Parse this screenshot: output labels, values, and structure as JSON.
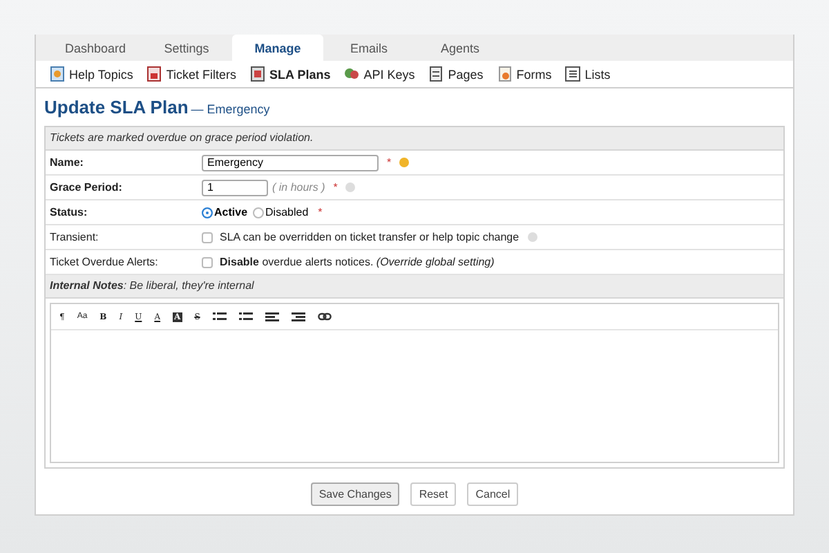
{
  "tabs": [
    {
      "label": "Dashboard",
      "selected": false
    },
    {
      "label": "Settings",
      "selected": false
    },
    {
      "label": "Manage",
      "selected": true
    },
    {
      "label": "Emails",
      "selected": false
    },
    {
      "label": "Agents",
      "selected": false
    }
  ],
  "subnav": [
    {
      "label": "Help Topics",
      "selected": false
    },
    {
      "label": "Ticket Filters",
      "selected": false
    },
    {
      "label": "SLA Plans",
      "selected": true
    },
    {
      "label": "API Keys",
      "selected": false
    },
    {
      "label": "Pages",
      "selected": false
    },
    {
      "label": "Forms",
      "selected": false
    },
    {
      "label": "Lists",
      "selected": false
    }
  ],
  "page_title": "Update SLA Plan",
  "page_subtitle": "— Emergency",
  "form": {
    "header": "Tickets are marked overdue on grace period violation.",
    "rows": [
      {
        "kind": "text",
        "label": "Name:",
        "required": true,
        "value": "Emergency",
        "mark": "*",
        "help": true
      },
      {
        "kind": "number",
        "label": "Grace Period:",
        "required": true,
        "value": "1",
        "unit": "( in hours )",
        "mark": "*",
        "help": true
      },
      {
        "kind": "radio",
        "label": "Status:",
        "required": true,
        "mark": "*",
        "options": [
          {
            "label": "Active",
            "selected": true
          },
          {
            "label": "Disabled",
            "selected": false
          }
        ]
      },
      {
        "kind": "checkbox",
        "label": "Transient:",
        "required": false,
        "checked": false,
        "text": "SLA can be overridden on ticket transfer or help topic change",
        "help": true
      },
      {
        "kind": "checkbox",
        "label": "Ticket Overdue Alerts:",
        "required": false,
        "checked": false,
        "text": "**Disable** overdue alerts notices. *(Override global setting)*",
        "help": false
      }
    ],
    "notes_header": "**Internal Notes**: Be liberal, they're internal",
    "toolbar": [
      {
        "kind": "glyph",
        "label": "¶"
      },
      {
        "kind": "glyph",
        "label": "Aa"
      },
      {
        "kind": "glyph",
        "label": "B"
      },
      {
        "kind": "glyph",
        "label": "I"
      },
      {
        "kind": "glyph",
        "label": "U"
      },
      {
        "kind": "glyph",
        "label": "A"
      },
      {
        "kind": "boxed",
        "label": "A"
      },
      {
        "kind": "glyph",
        "label": "S"
      },
      {
        "kind": "bullet-list"
      },
      {
        "kind": "number-list"
      },
      {
        "kind": "outdent"
      },
      {
        "kind": "indent"
      },
      {
        "kind": "link"
      }
    ]
  },
  "buttons": [
    {
      "label": "Save Changes",
      "primary": true
    },
    {
      "label": "Reset",
      "primary": false
    },
    {
      "label": "Cancel",
      "primary": false
    }
  ]
}
